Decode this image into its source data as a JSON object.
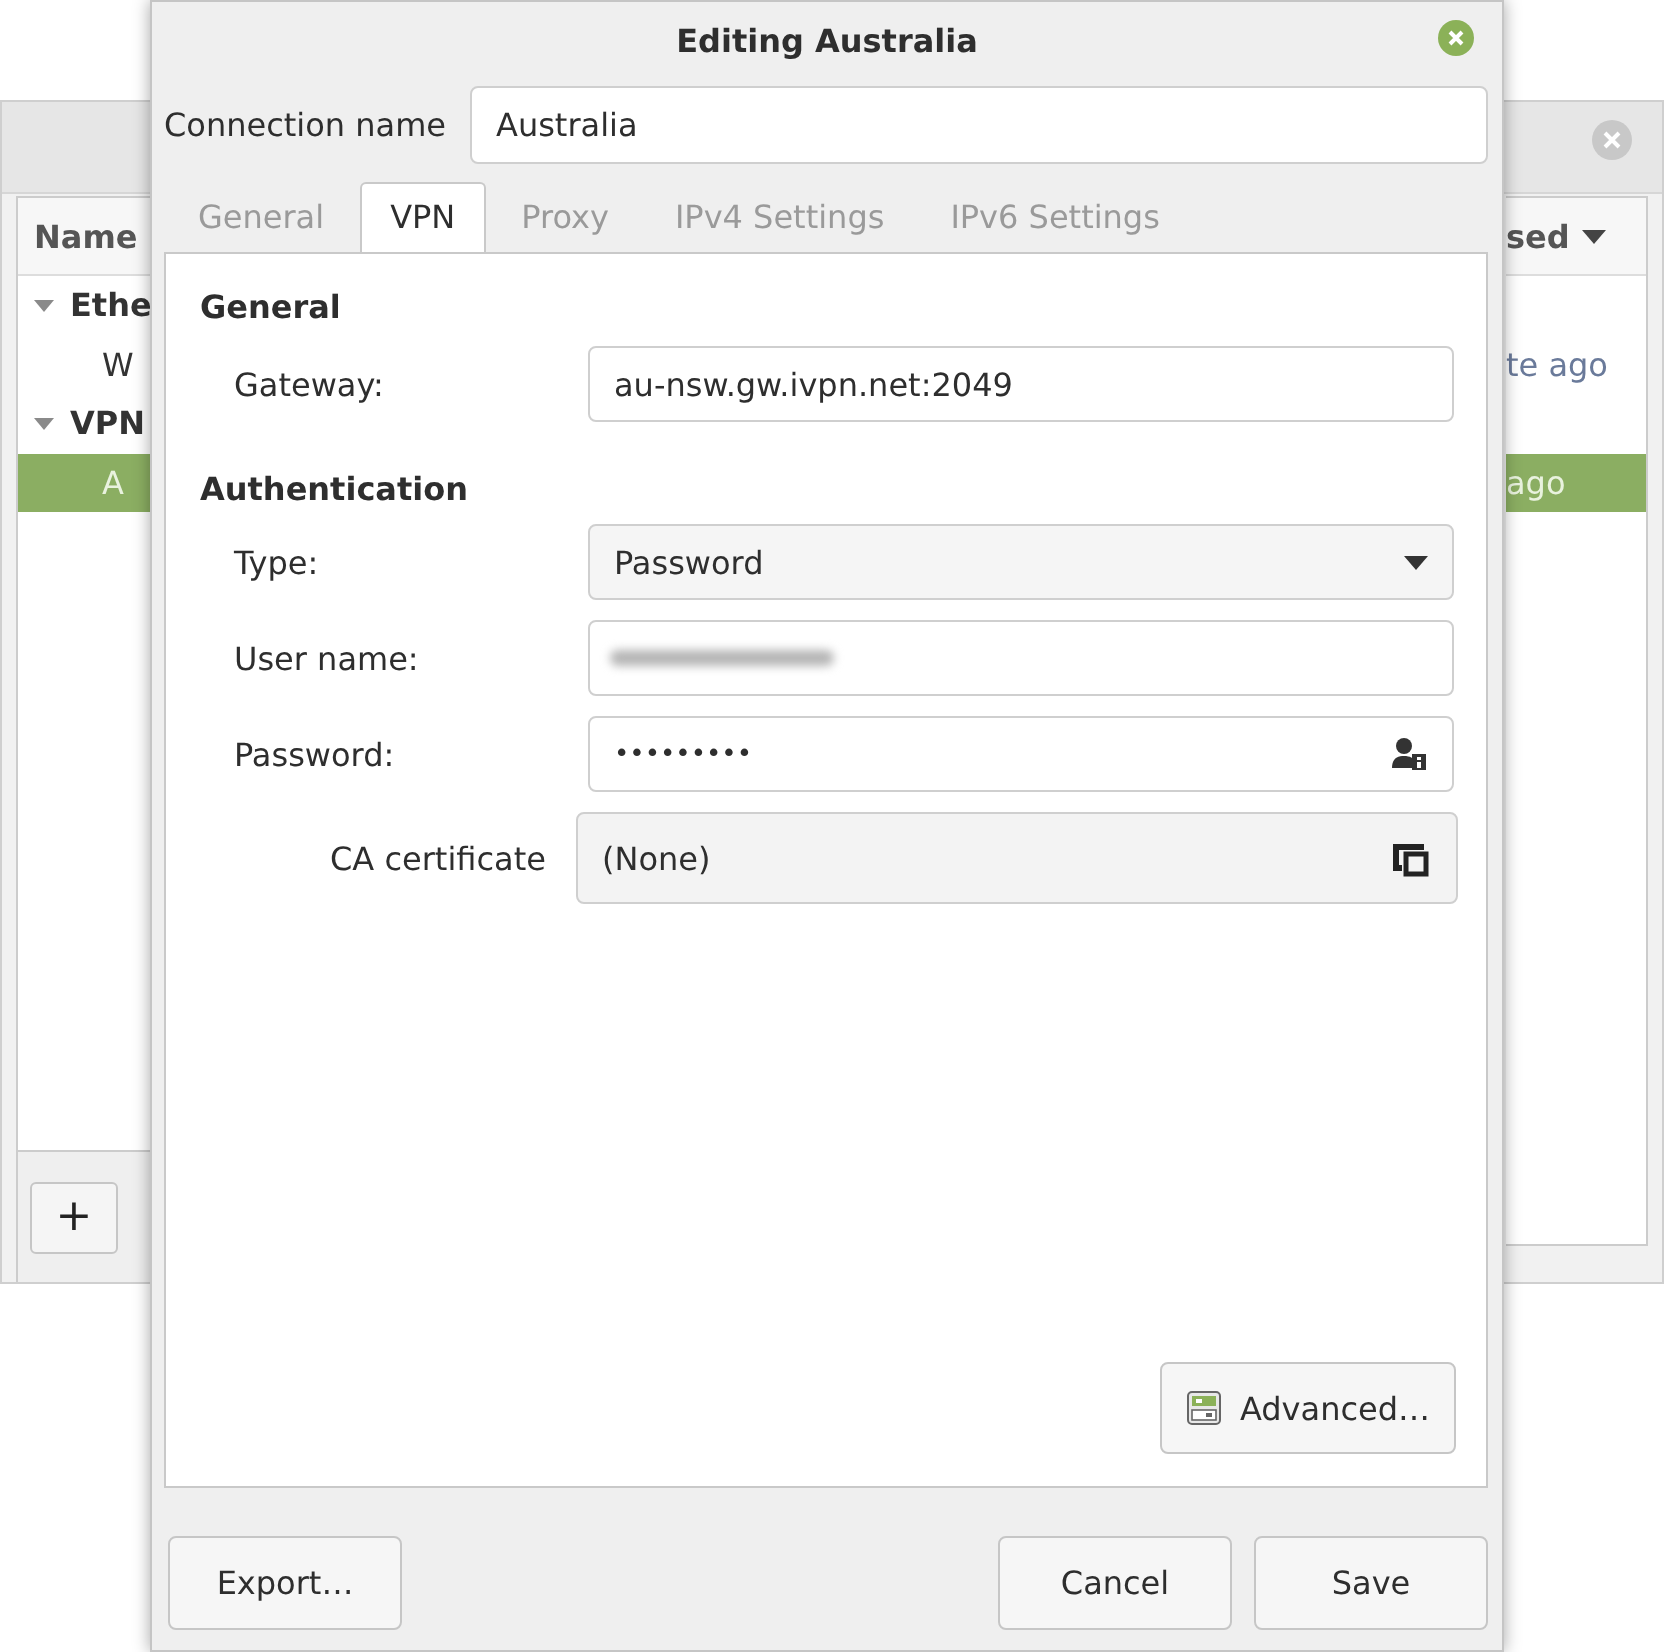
{
  "background_window": {
    "left_columns": {
      "header": "Name",
      "rows": [
        {
          "label": "Ethe",
          "kind": "group",
          "expanded": true,
          "selected": false
        },
        {
          "label": "W",
          "kind": "item",
          "selected": false
        },
        {
          "label": "VPN",
          "kind": "group",
          "expanded": true,
          "selected": false
        },
        {
          "label": "A",
          "kind": "item",
          "selected": true
        }
      ]
    },
    "right_columns": {
      "header": "sed",
      "rows": [
        {
          "label": "",
          "selected": false
        },
        {
          "label": "te ago",
          "selected": false
        },
        {
          "label": "",
          "selected": false
        },
        {
          "label": "ago",
          "selected": true
        }
      ]
    },
    "add_button": "+"
  },
  "window": {
    "title": "Editing Australia"
  },
  "connection_name": {
    "label": "Connection name",
    "value": "Australia"
  },
  "tabs": [
    {
      "label": "General",
      "selected": false
    },
    {
      "label": "VPN",
      "selected": true
    },
    {
      "label": "Proxy",
      "selected": false
    },
    {
      "label": "IPv4 Settings",
      "selected": false
    },
    {
      "label": "IPv6 Settings",
      "selected": false
    }
  ],
  "general": {
    "heading": "General",
    "gateway": {
      "label": "Gateway:",
      "value": "au-nsw.gw.ivpn.net:2049"
    }
  },
  "authentication": {
    "heading": "Authentication",
    "type": {
      "label": "Type:",
      "value": "Password"
    },
    "user_name": {
      "label": "User name:",
      "blurred": true
    },
    "password": {
      "label": "Password:",
      "value": "•••••••••"
    },
    "ca_certificate": {
      "label": "CA certificate",
      "value": "(None)"
    }
  },
  "advanced_button": "Advanced…",
  "buttons": [
    {
      "label": "Export…",
      "kind": "left"
    },
    {
      "label": "Cancel",
      "kind": "right"
    },
    {
      "label": "Save",
      "kind": "right"
    }
  ]
}
